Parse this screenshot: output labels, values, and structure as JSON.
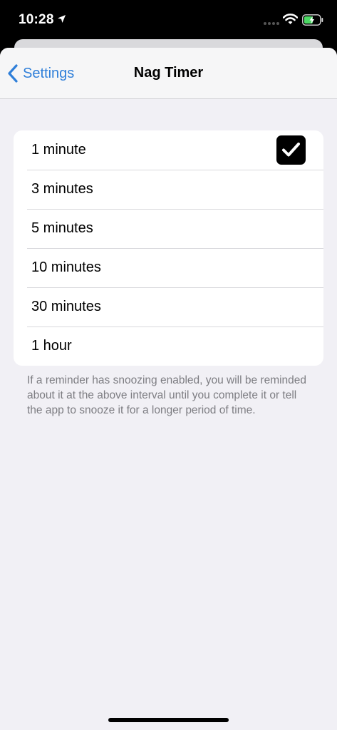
{
  "status_bar": {
    "time": "10:28",
    "icons": [
      "location-arrow-icon",
      "cellular-signal-icon",
      "wifi-icon",
      "battery-charging-icon"
    ],
    "battery_color": "#4cd964"
  },
  "navbar": {
    "back_label": "Settings",
    "title": "Nag Timer"
  },
  "options": [
    {
      "label": "1 minute",
      "selected": true
    },
    {
      "label": "3 minutes",
      "selected": false
    },
    {
      "label": "5 minutes",
      "selected": false
    },
    {
      "label": "10 minutes",
      "selected": false
    },
    {
      "label": "30 minutes",
      "selected": false
    },
    {
      "label": "1 hour",
      "selected": false
    }
  ],
  "footer_note": "If a reminder has snoozing enabled, you will be reminded about it at the above interval until you complete it or tell the app to snooze it for a longer period of time.",
  "colors": {
    "accent": "#2f7fd9",
    "background": "#f1f0f5",
    "secondary_text": "#7d7d82"
  }
}
